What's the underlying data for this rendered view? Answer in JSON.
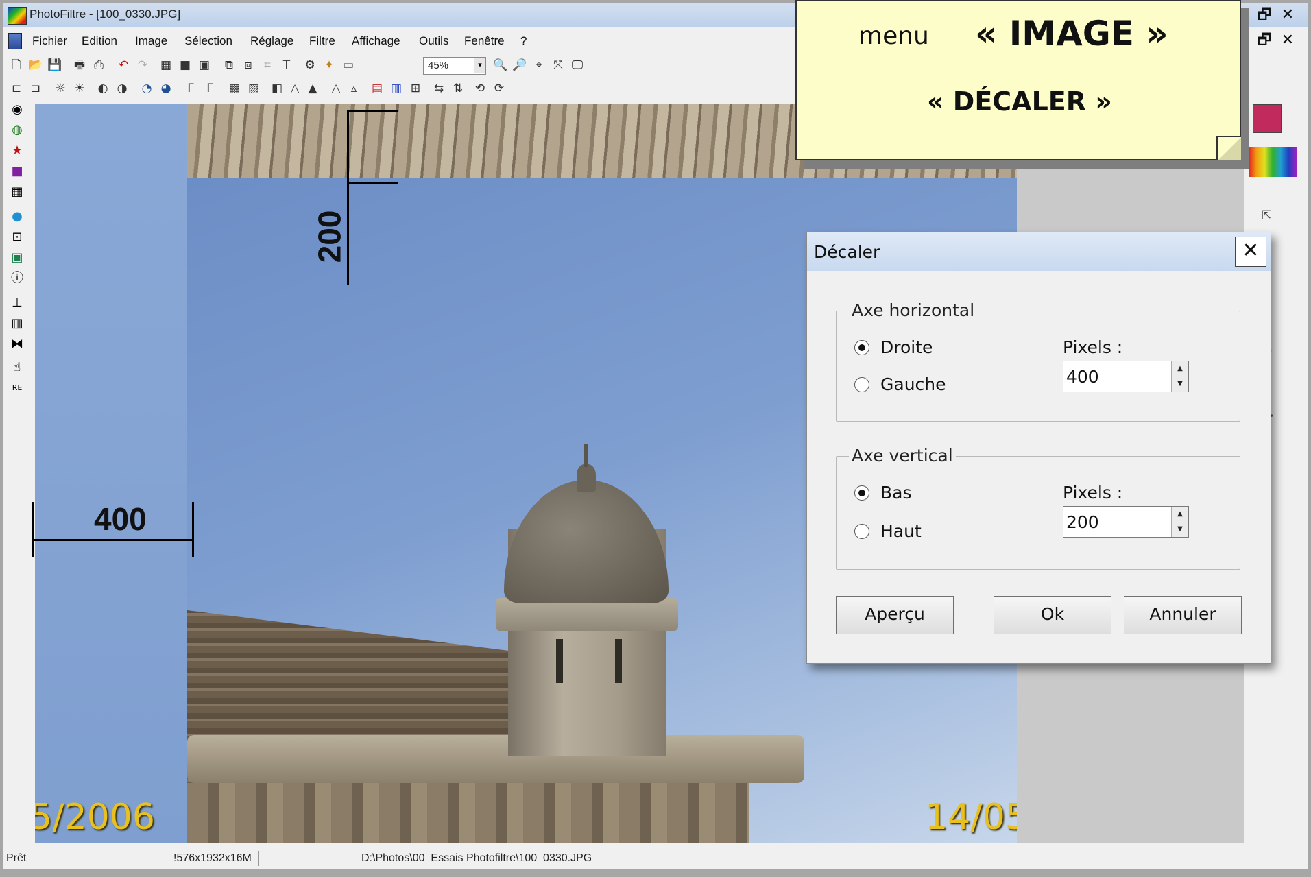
{
  "window": {
    "title": "PhotoFiltre - [100_0330.JPG]",
    "restore_glyph": "🗗",
    "close_glyph": "✕"
  },
  "menubar": {
    "items": [
      "Fichier",
      "Edition",
      "Image",
      "Sélection",
      "Réglage",
      "Filtre",
      "Affichage",
      "Outils",
      "Fenêtre",
      "?"
    ]
  },
  "toolbar": {
    "zoom_value": "45%"
  },
  "canvas": {
    "date_left": "5/2006",
    "date_right": "14/05",
    "offset_vertical_label": "200",
    "offset_horizontal_label": "400"
  },
  "note": {
    "menu_word": "menu",
    "image_label": "« IMAGE »",
    "decaler_label": "« DÉCALER »"
  },
  "dialog": {
    "title": "Décaler",
    "close_glyph": "✕",
    "horizontal": {
      "legend": "Axe horizontal",
      "option_right": "Droite",
      "option_left": "Gauche",
      "selected": "Droite",
      "pixels_label": "Pixels :",
      "pixels_value": "400"
    },
    "vertical": {
      "legend": "Axe vertical",
      "option_down": "Bas",
      "option_up": "Haut",
      "selected": "Bas",
      "pixels_label": "Pixels :",
      "pixels_value": "200"
    },
    "buttons": {
      "preview": "Aperçu",
      "ok": "Ok",
      "cancel": "Annuler"
    }
  },
  "statusbar": {
    "state": "Prêt",
    "dimensions": "!576x1932x16M",
    "path": "D:\\Photos\\00_Essais Photofiltre\\100_0330.JPG"
  },
  "colors": {
    "foreground_swatch": "#c02a5c",
    "note_background": "#fdfdca",
    "date_stamp": "#e8c020"
  }
}
